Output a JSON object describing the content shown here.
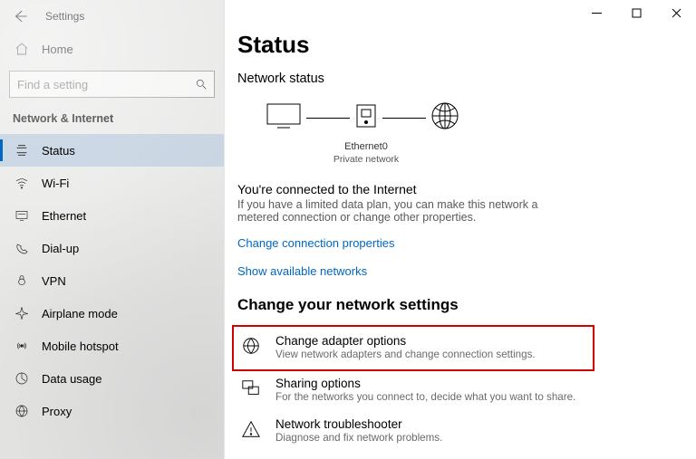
{
  "app": {
    "title": "Settings"
  },
  "home": {
    "label": "Home"
  },
  "search": {
    "placeholder": "Find a setting"
  },
  "section": {
    "title": "Network & Internet"
  },
  "nav": [
    {
      "id": "status",
      "label": "Status",
      "selected": true
    },
    {
      "id": "wifi",
      "label": "Wi-Fi",
      "selected": false
    },
    {
      "id": "ethernet",
      "label": "Ethernet",
      "selected": false
    },
    {
      "id": "dialup",
      "label": "Dial-up",
      "selected": false
    },
    {
      "id": "vpn",
      "label": "VPN",
      "selected": false
    },
    {
      "id": "airplane",
      "label": "Airplane mode",
      "selected": false
    },
    {
      "id": "hotspot",
      "label": "Mobile hotspot",
      "selected": false
    },
    {
      "id": "data",
      "label": "Data usage",
      "selected": false
    },
    {
      "id": "proxy",
      "label": "Proxy",
      "selected": false
    }
  ],
  "page": {
    "title": "Status",
    "section_status": "Network status",
    "adapter_name": "Ethernet0",
    "adapter_net": "Private network",
    "connected_heading": "You're connected to the Internet",
    "connected_body": "If you have a limited data plan, you can make this network a metered connection or change other properties.",
    "link_change_props": "Change connection properties",
    "link_show_networks": "Show available networks",
    "section_change": "Change your network settings",
    "settings": [
      {
        "id": "adapter",
        "title": "Change adapter options",
        "desc": "View network adapters and change connection settings.",
        "highlighted": true
      },
      {
        "id": "sharing",
        "title": "Sharing options",
        "desc": "For the networks you connect to, decide what you want to share."
      },
      {
        "id": "trouble",
        "title": "Network troubleshooter",
        "desc": "Diagnose and fix network problems."
      }
    ]
  }
}
